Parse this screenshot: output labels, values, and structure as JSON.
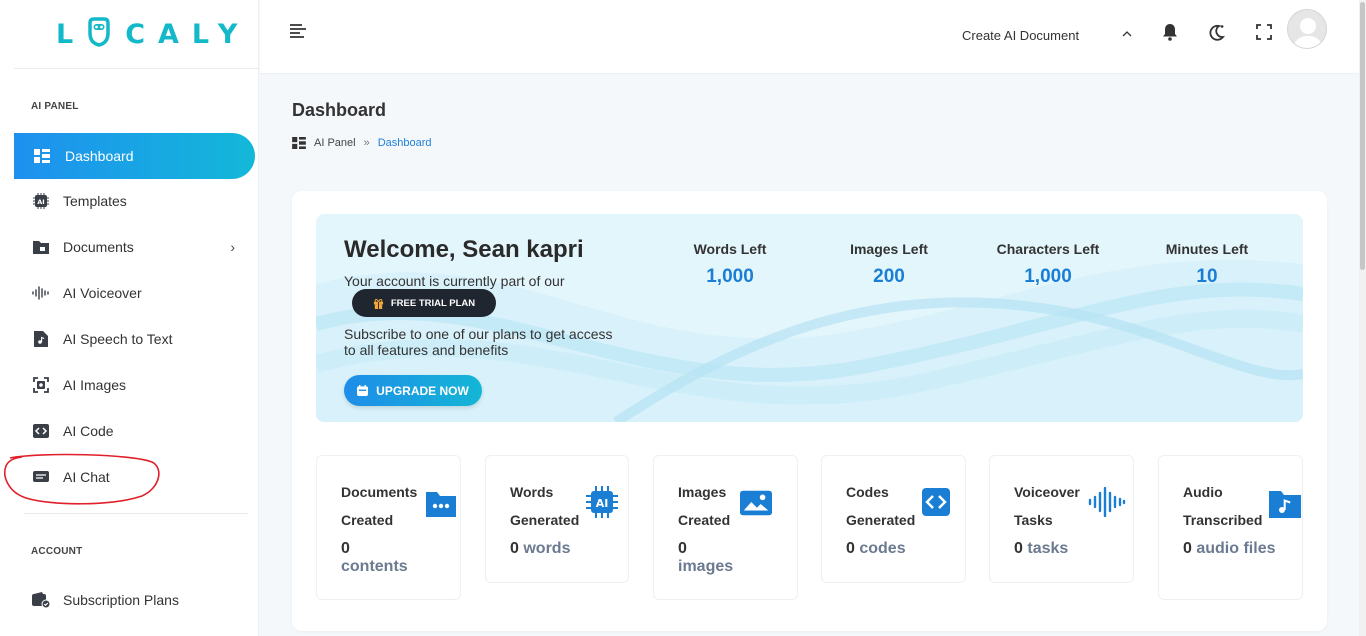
{
  "app": {
    "logo_left": "L",
    "logo_right": "CALY"
  },
  "sidebar": {
    "section_ai": "AI PANEL",
    "section_account": "ACCOUNT",
    "items": [
      {
        "label": "Dashboard",
        "icon": "dashboard-grid-icon",
        "active": true
      },
      {
        "label": "Templates",
        "icon": "ai-chip-icon"
      },
      {
        "label": "Documents",
        "icon": "folder-icon",
        "has_submenu": true
      },
      {
        "label": "AI Voiceover",
        "icon": "sound-wave-icon"
      },
      {
        "label": "AI Speech to Text",
        "icon": "music-file-icon"
      },
      {
        "label": "AI Images",
        "icon": "image-scan-icon"
      },
      {
        "label": "AI Code",
        "icon": "code-icon"
      },
      {
        "label": "AI Chat",
        "icon": "chat-box-icon"
      }
    ],
    "account_items": [
      {
        "label": "Subscription Plans",
        "icon": "wallet-check-icon"
      }
    ]
  },
  "topbar": {
    "create_label": "Create AI Document",
    "icons": [
      "hamburger-menu-icon",
      "chevron-up-icon",
      "bell-icon",
      "moon-icon",
      "fullscreen-icon",
      "avatar"
    ]
  },
  "page": {
    "title": "Dashboard",
    "breadcrumb": {
      "root": "AI Panel",
      "separator": "»",
      "current": "Dashboard"
    }
  },
  "welcome": {
    "greeting": "Welcome, Sean kapri",
    "account_text": "Your account is currently part of our",
    "plan_label": "FREE TRIAL PLAN",
    "subscribe_text": "Subscribe to one of our plans to get access to all features and benefits",
    "upgrade_label": "UPGRADE NOW"
  },
  "quotas": [
    {
      "label": "Words Left",
      "value": "1,000"
    },
    {
      "label": "Images Left",
      "value": "200"
    },
    {
      "label": "Characters Left",
      "value": "1,000"
    },
    {
      "label": "Minutes Left",
      "value": "10"
    }
  ],
  "stats": [
    {
      "line1": "Documents",
      "line2": "Created",
      "value": "0",
      "unit": "contents",
      "icon": "folder-dots-icon"
    },
    {
      "line1": "Words",
      "line2": "Generated",
      "value": "0",
      "unit": "words",
      "icon": "ai-chip-icon"
    },
    {
      "line1": "Images",
      "line2": "Created",
      "value": "0",
      "unit": "images",
      "icon": "image-icon"
    },
    {
      "line1": "Codes",
      "line2": "Generated",
      "value": "0",
      "unit": "codes",
      "icon": "code-icon"
    },
    {
      "line1": "Voiceover",
      "line2": "Tasks",
      "value": "0",
      "unit": "tasks",
      "icon": "sound-wave-icon"
    },
    {
      "line1": "Audio",
      "line2": "Transcribed",
      "value": "0",
      "unit": "audio files",
      "icon": "music-file-icon"
    }
  ],
  "colors": {
    "accent": "#1a7fd4",
    "accent2": "#13b8c9",
    "annotation": "#e0202a",
    "banner_bg": "#e3f6fc"
  }
}
